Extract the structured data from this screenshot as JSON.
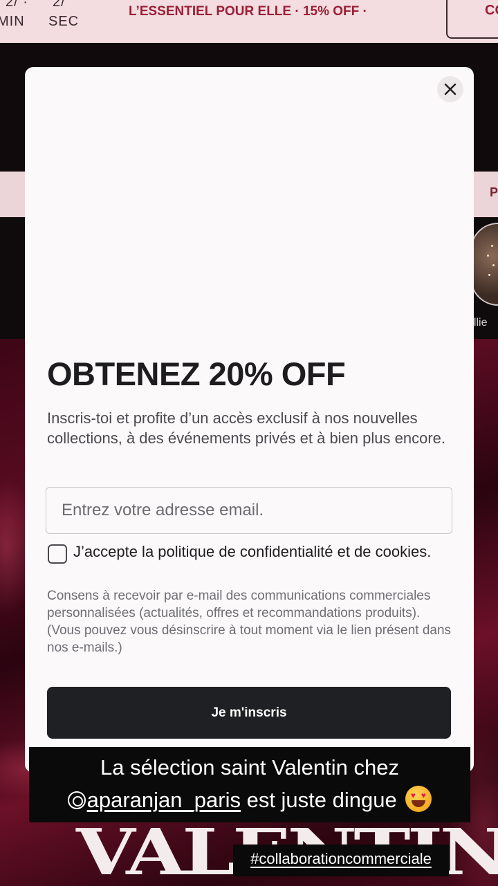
{
  "promo_bar": {
    "countdown_top_left": "2/ ·",
    "countdown_top_right": "2/",
    "min_label": "MIN",
    "sec_label": "SEC",
    "promo_text": "L’ESSENTIEL POUR ELLE · 15% OFF ·",
    "cta_partial": "CO"
  },
  "nav": {
    "partial_label": "P"
  },
  "stories": {
    "label_partial": "ollie"
  },
  "modal": {
    "title": "OBTENEZ 20% OFF",
    "description": "Inscris-toi et profite d’un accès exclusif à nos nouvelles collections, à des événements privés et à bien plus encore.",
    "email_placeholder": "Entrez votre adresse email.",
    "consent_checkbox_label": "J’accepte la politique de confidentialité et de cookies.",
    "consent_text": "Consens à recevoir par e-mail des communications commerciales personnalisées (actualités, offres et recommandations produits). (Vous pouvez vous désinscrire à tout moment via le lien présent dans nos e-mails.)",
    "submit_label": "Je m'inscris",
    "close_glyph": "✕"
  },
  "caption": {
    "line1": "La sélection saint Valentin chez",
    "mention": "aparanjan_paris",
    "line2_rest": " est juste dingue",
    "hashtag": "#collaborationcommerciale"
  },
  "background_art": {
    "text": "VALENTINE"
  },
  "colors": {
    "promo_bg": "#f3dde0",
    "promo_text": "#9a1e36",
    "modal_bg": "#fcf9fb",
    "button_bg": "#1f2023",
    "satin_red": "#5a0c22"
  },
  "icons": [
    "close-icon",
    "threads-mention-icon",
    "heart-eyes-emoji-icon",
    "checkbox-icon"
  ]
}
